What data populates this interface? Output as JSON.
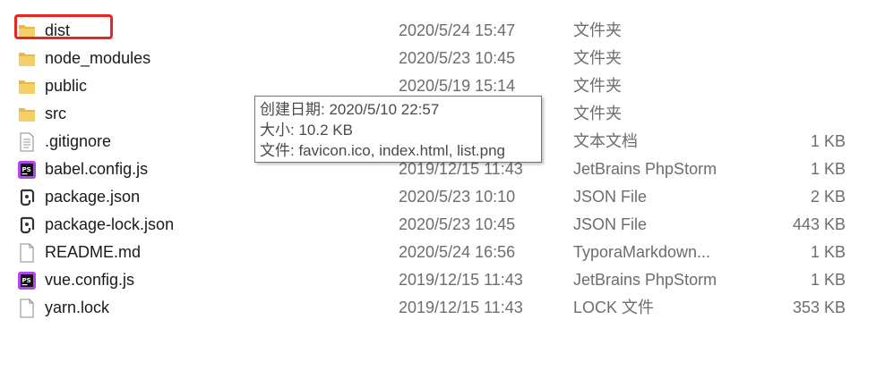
{
  "files": [
    {
      "name": "dist",
      "date": "2020/5/24 15:47",
      "type": "文件夹",
      "size": "",
      "icon": "folder-icon"
    },
    {
      "name": "node_modules",
      "date": "2020/5/23 10:45",
      "type": "文件夹",
      "size": "",
      "icon": "folder-icon"
    },
    {
      "name": "public",
      "date": "2020/5/19 15:14",
      "type": "文件夹",
      "size": "",
      "icon": "folder-icon"
    },
    {
      "name": "src",
      "date": "",
      "type": "文件夹",
      "size": "",
      "icon": "folder-icon"
    },
    {
      "name": ".gitignore",
      "date": "",
      "type": "文本文档",
      "size": "1 KB",
      "icon": "text-file-icon"
    },
    {
      "name": "babel.config.js",
      "date": "2019/12/15 11:43",
      "type": "JetBrains PhpStorm",
      "size": "1 KB",
      "icon": "phpstorm-icon"
    },
    {
      "name": "package.json",
      "date": "2020/5/23 10:10",
      "type": "JSON File",
      "size": "2 KB",
      "icon": "json-file-icon"
    },
    {
      "name": "package-lock.json",
      "date": "2020/5/23 10:45",
      "type": "JSON File",
      "size": "443 KB",
      "icon": "json-file-icon"
    },
    {
      "name": "README.md",
      "date": "2020/5/24 16:56",
      "type": "TyporaMarkdown...",
      "size": "1 KB",
      "icon": "blank-file-icon"
    },
    {
      "name": "vue.config.js",
      "date": "2019/12/15 11:43",
      "type": "JetBrains PhpStorm",
      "size": "1 KB",
      "icon": "phpstorm-icon"
    },
    {
      "name": "yarn.lock",
      "date": "2019/12/15 11:43",
      "type": "LOCK 文件",
      "size": "353 KB",
      "icon": "blank-file-icon"
    }
  ],
  "tooltip": {
    "created": "创建日期: 2020/5/10 22:57",
    "size": "大小: 10.2 KB",
    "files": "文件: favicon.ico, index.html, list.png"
  },
  "colors": {
    "highlight_border": "#e8251f",
    "folder": "#e8b84a",
    "phpstorm_accent": "#b345f1"
  }
}
